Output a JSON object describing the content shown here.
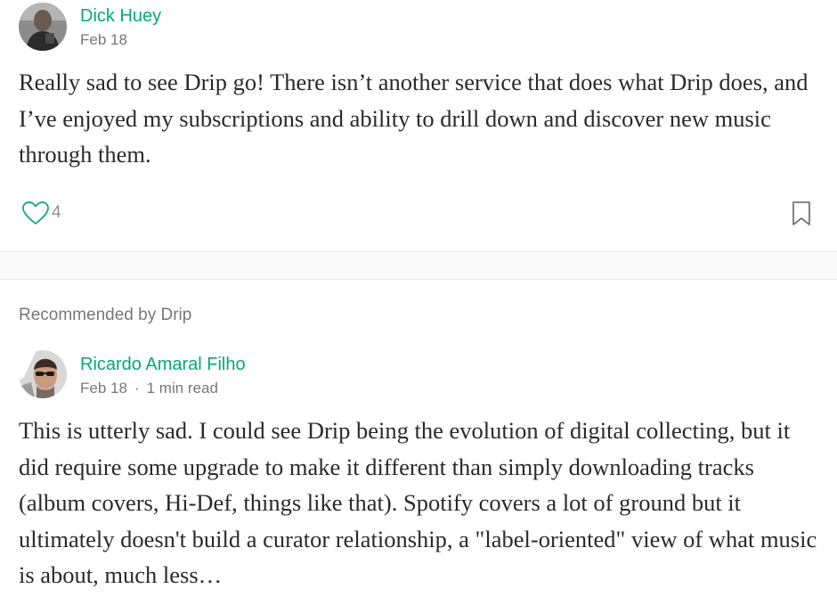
{
  "colors": {
    "accent": "#03a87c",
    "text": "#292929",
    "muted": "#8a8a8a",
    "divider": "#e6e6e6",
    "band": "#fafafa"
  },
  "responses": [
    {
      "author": "Dick Huey",
      "date": "Feb 18",
      "body": "Really sad to see Drip go! There isn’t another service that does what Drip does, and I’ve enjoyed my subscriptions and ability to drill down and discover new music through them.",
      "likes": "4",
      "like_icon": "heart-outline-icon",
      "bookmark_icon": "bookmark-outline-icon"
    }
  ],
  "recommended": {
    "label": "Recommended by Drip",
    "author": "Ricardo Amaral Filho",
    "date": "Feb 18",
    "separator": "·",
    "read_time": "1 min read",
    "body": "This is utterly sad. I could see Drip being the evolution of digital collecting, but it did require some upgrade to make it different than simply downloading tracks (album covers, Hi-Def, things like that). Spotify covers a lot of ground but it ultimately doesn't build a curator relationship, a \"label-oriented\" view of what music is about, much less…"
  }
}
